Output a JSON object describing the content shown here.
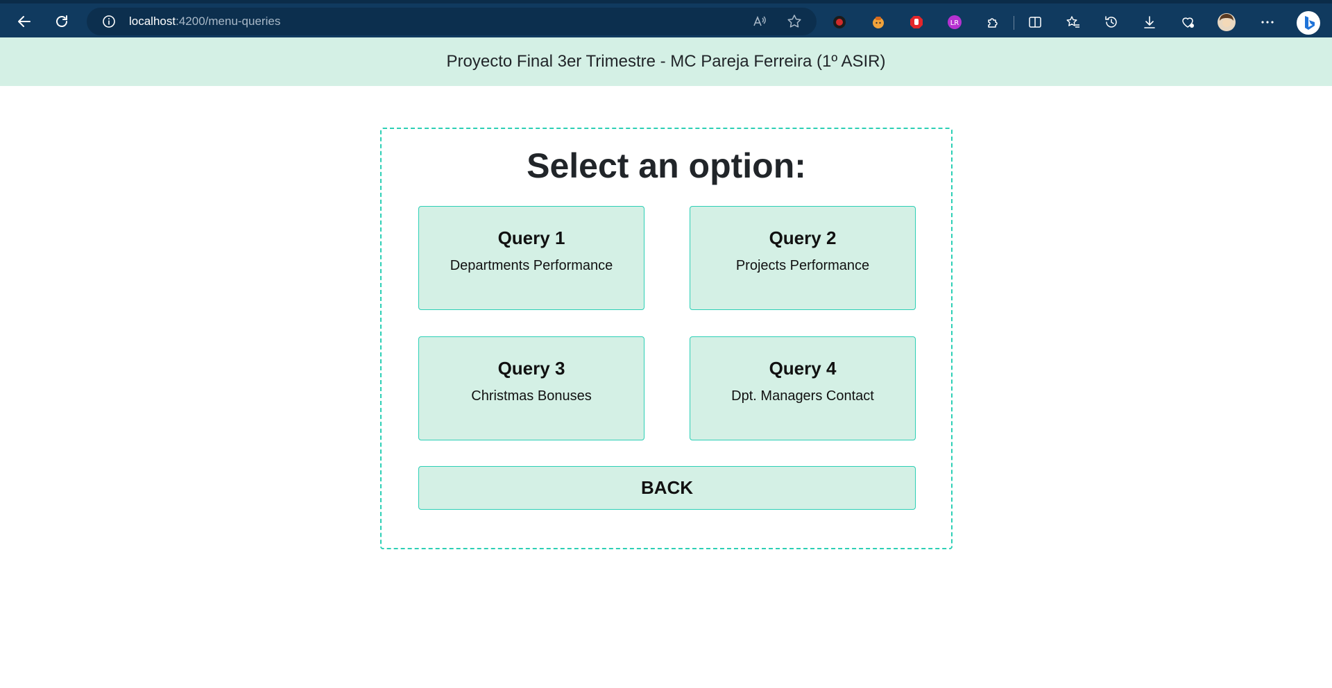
{
  "browser": {
    "url_host": "localhost",
    "url_path": ":4200/menu-queries"
  },
  "header": {
    "title": "Proyecto Final 3er Trimestre - MC Pareja Ferreira (1º ASIR)"
  },
  "menu": {
    "title": "Select an option:",
    "queries": [
      {
        "title": "Query 1",
        "description": "Departments Performance"
      },
      {
        "title": "Query 2",
        "description": "Projects Performance"
      },
      {
        "title": "Query 3",
        "description": "Christmas Bonuses"
      },
      {
        "title": "Query 4",
        "description": "Dpt. Managers Contact"
      }
    ],
    "back_label": "BACK"
  },
  "colors": {
    "browser_bar": "#103a5f",
    "header_bg": "#d4f0e5",
    "accent_border": "#2ccfb5"
  }
}
